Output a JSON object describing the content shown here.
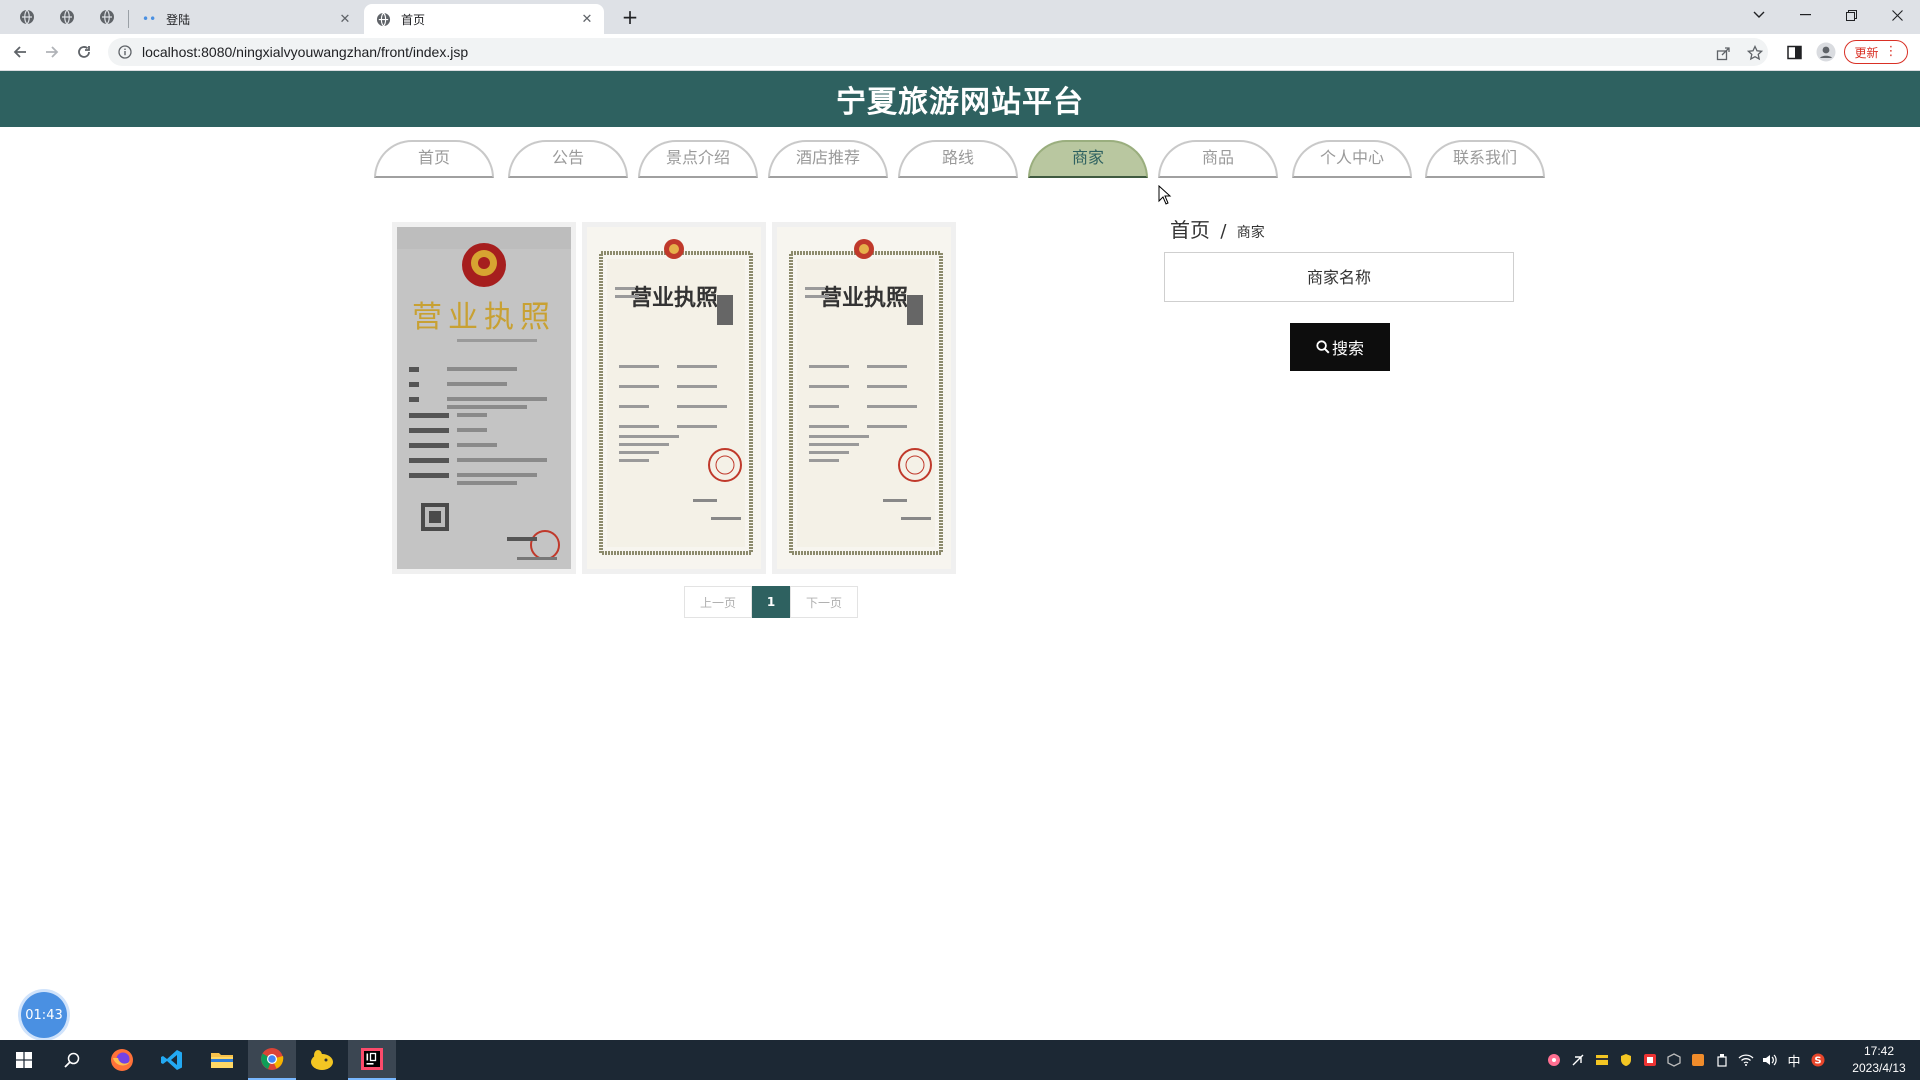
{
  "browser": {
    "tabs": [
      {
        "title": "登陆"
      },
      {
        "title": "首页"
      }
    ],
    "new_tab_label": "+",
    "url": "localhost:8080/ningxialvyouwangzhan/front/index.jsp",
    "update_label": "更新"
  },
  "site": {
    "title": "宁夏旅游网站平台",
    "nav": [
      "首页",
      "公告",
      "景点介绍",
      "酒店推荐",
      "路线",
      "商家",
      "商品",
      "个人中心",
      "联系我们"
    ],
    "active_nav": "商家"
  },
  "breadcrumb": {
    "home": "首页",
    "separator": "/",
    "current": "商家"
  },
  "search": {
    "placeholder": "商家名称",
    "button_label": "搜索"
  },
  "merchant_cards": [
    {
      "image": "business-license-photo",
      "heading": "营业执照"
    },
    {
      "image": "business-license-certificate",
      "heading": "营业执照"
    },
    {
      "image": "business-license-certificate",
      "heading": "营业执照"
    }
  ],
  "pagination": {
    "prev_label": "上一页",
    "current_page": "1",
    "next_label": "下一页"
  },
  "timer_badge": "01:43",
  "taskbar": {
    "apps": [
      "start",
      "search",
      "firefox",
      "vscode",
      "file-explorer",
      "chrome",
      "app-yellow",
      "intellij"
    ],
    "ime": "中",
    "time": "17:42",
    "date": "2023/4/13"
  },
  "colors": {
    "header_bg": "#2e6160",
    "nav_active_bg": "#b9c7a0",
    "search_button_bg": "#0d0d0d",
    "pager_active_bg": "#2e6160"
  }
}
